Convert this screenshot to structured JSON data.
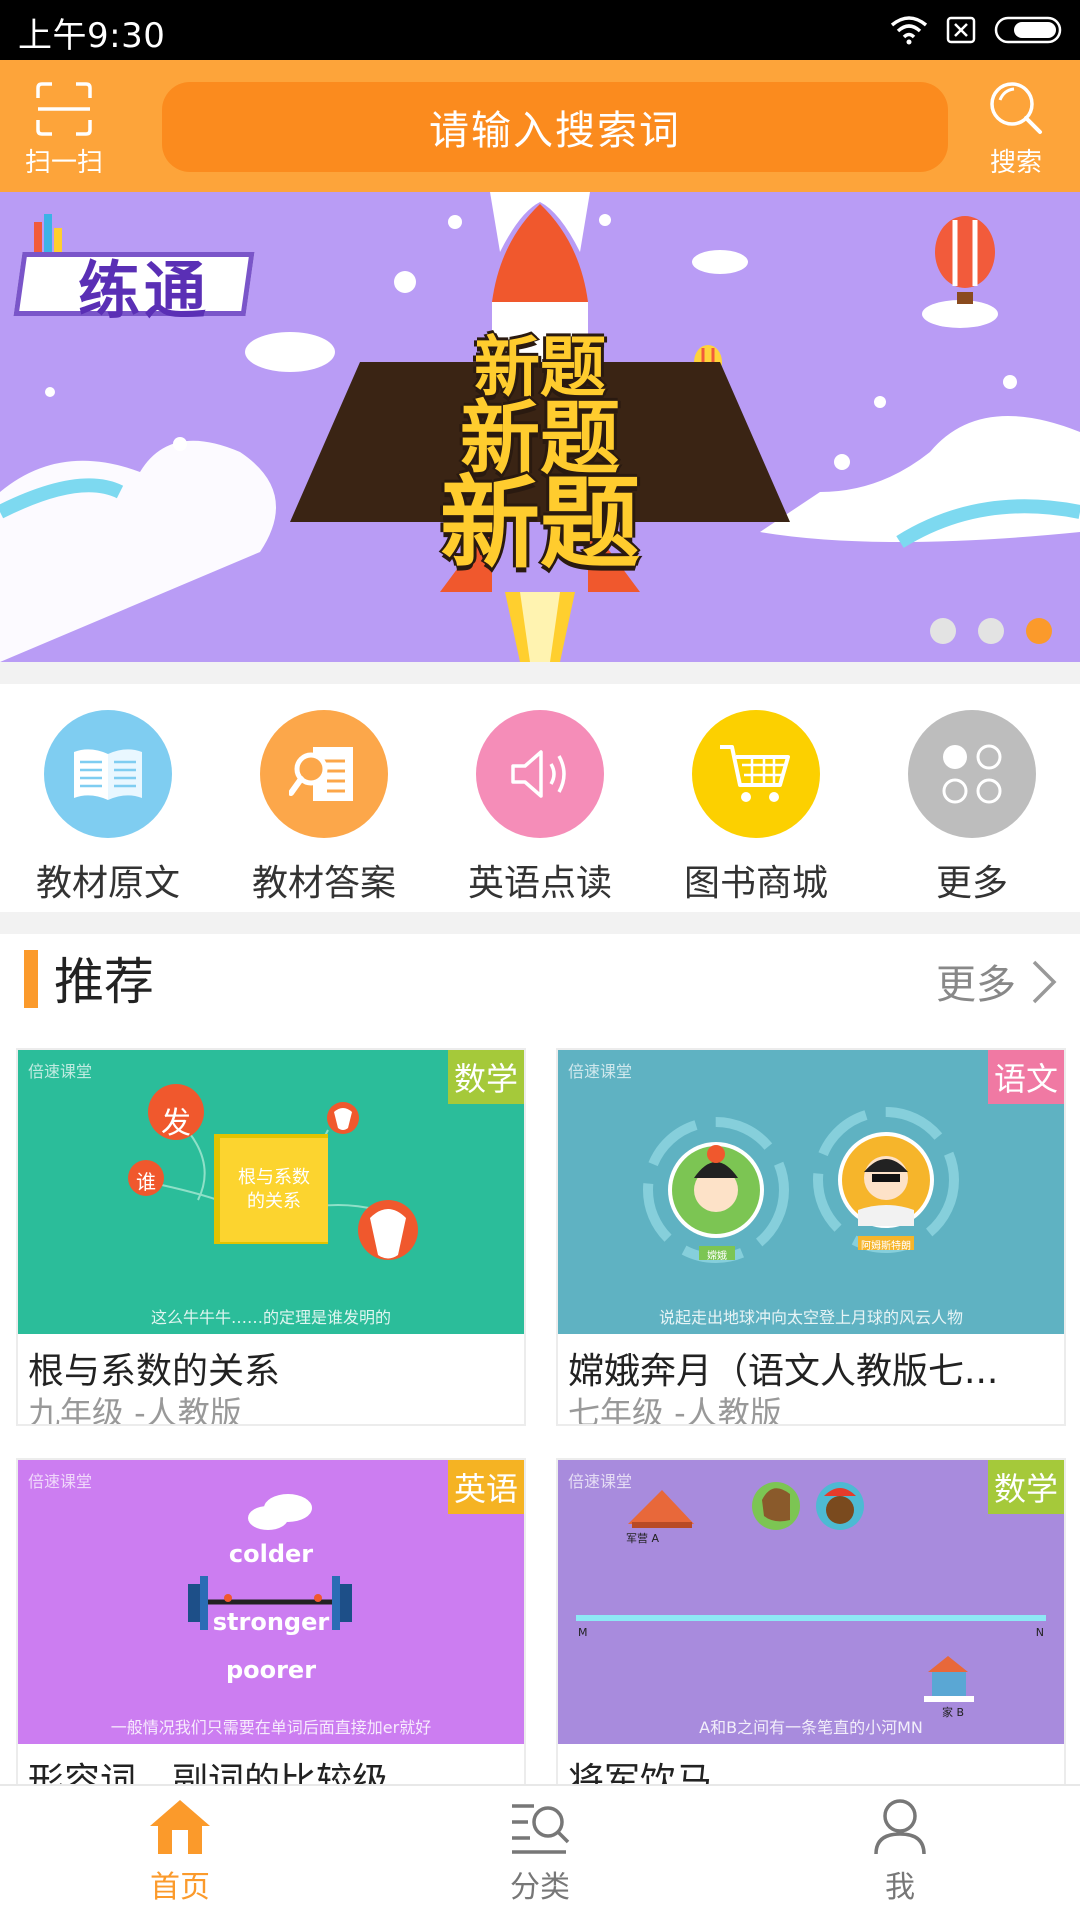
{
  "status_bar": {
    "time": "上午9:30"
  },
  "header": {
    "scan_label": "扫一扫",
    "search_placeholder": "请输入搜索词",
    "search_label": "搜索"
  },
  "banner": {
    "logo_text": "练通",
    "lines": [
      "新题",
      "新题",
      "新题"
    ],
    "page_count": 3,
    "active_page": 3
  },
  "shortcuts": [
    {
      "label": "教材原文",
      "icon": "book-icon",
      "color": "#7fcdf1"
    },
    {
      "label": "教材答案",
      "icon": "document-search-icon",
      "color": "#fca74a"
    },
    {
      "label": "英语点读",
      "icon": "speaker-icon",
      "color": "#f58db8"
    },
    {
      "label": "图书商城",
      "icon": "cart-icon",
      "color": "#fcd000"
    },
    {
      "label": "更多",
      "icon": "grid-circles-icon",
      "color": "#bdbdbd"
    }
  ],
  "recommend": {
    "title": "推荐",
    "more_label": "更多",
    "cards": [
      {
        "tag": "数学",
        "tag_color": "#a5c93a",
        "bg": "#2bbd9a",
        "brand": "倍速课堂",
        "caption": "这么牛牛牛……的定理是谁发明的",
        "title": "根与系数的关系",
        "subtitle": "九年级 -人教版",
        "center_text": "根与系数\n的关系",
        "bubble1": "发",
        "bubble2": "谁"
      },
      {
        "tag": "语文",
        "tag_color": "#f079a3",
        "bg": "#5fb2c2",
        "brand": "倍速课堂",
        "caption": "说起走出地球冲向太空登上月球的风云人物",
        "title": "嫦娥奔月（语文人教版七...",
        "subtitle": "七年级 -人教版",
        "label_left": "嫦娥",
        "label_right": "阿姆斯特朗"
      },
      {
        "tag": "英语",
        "tag_color": "#f5b323",
        "bg": "#cc7df1",
        "brand": "倍速课堂",
        "caption": "一般情况我们只需要在单词后面直接加er就好",
        "title": "形容词、副词的比较级",
        "subtitle": "",
        "word1": "colder",
        "word2": "stronger",
        "word3": "poorer"
      },
      {
        "tag": "数学",
        "tag_color": "#a5c93a",
        "bg": "#a88bdd",
        "brand": "倍速课堂",
        "caption": "A和B之间有一条笔直的小河MN",
        "title": "将军饮马",
        "subtitle": "",
        "label_a": "军营 A",
        "label_b": "家 B",
        "label_m": "M",
        "label_n": "N"
      }
    ]
  },
  "bottom_nav": [
    {
      "label": "首页",
      "icon": "home-icon",
      "active": true
    },
    {
      "label": "分类",
      "icon": "category-search-icon",
      "active": false
    },
    {
      "label": "我",
      "icon": "user-icon",
      "active": false
    }
  ],
  "colors": {
    "accent": "#fb9a2b",
    "header": "#fda43a",
    "search_bar": "#fb8b1e",
    "nav_inactive": "#777777"
  }
}
